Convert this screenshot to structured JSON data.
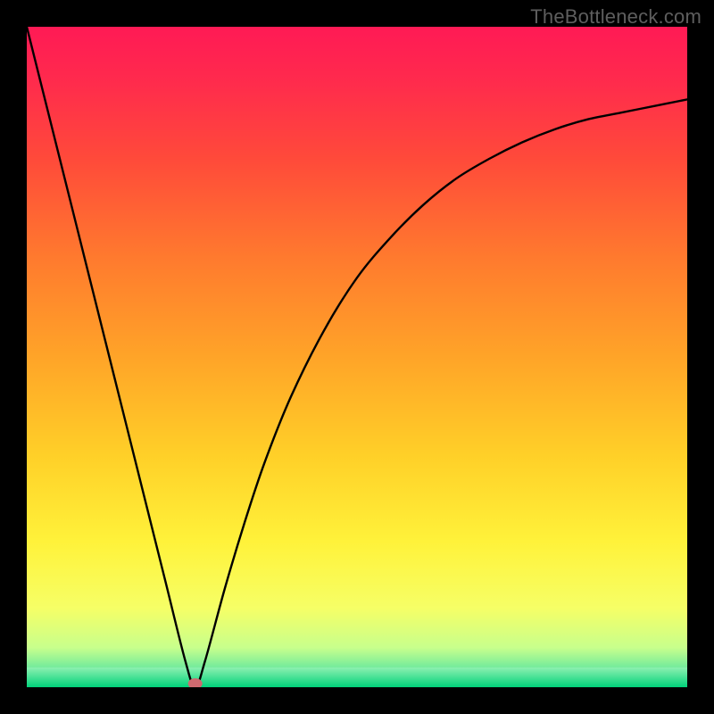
{
  "watermark": "TheBottleneck.com",
  "chart_data": {
    "type": "line",
    "title": "",
    "xlabel": "",
    "ylabel": "",
    "xlim": [
      0,
      100
    ],
    "ylim": [
      0,
      100
    ],
    "background_gradient": {
      "stops": [
        {
          "offset": 0.0,
          "color": "#ff1a55"
        },
        {
          "offset": 0.08,
          "color": "#ff2a4d"
        },
        {
          "offset": 0.2,
          "color": "#ff4a3a"
        },
        {
          "offset": 0.35,
          "color": "#ff7a2e"
        },
        {
          "offset": 0.5,
          "color": "#ffa428"
        },
        {
          "offset": 0.65,
          "color": "#ffd028"
        },
        {
          "offset": 0.78,
          "color": "#fff23a"
        },
        {
          "offset": 0.88,
          "color": "#f6ff66"
        },
        {
          "offset": 0.94,
          "color": "#c8ff8c"
        },
        {
          "offset": 0.975,
          "color": "#66e89e"
        },
        {
          "offset": 1.0,
          "color": "#00d27a"
        }
      ]
    },
    "series": [
      {
        "name": "bottleneck-curve",
        "x": [
          0,
          3,
          6,
          9,
          12,
          15,
          18,
          21,
          24,
          25.5,
          27,
          30,
          33,
          36,
          40,
          45,
          50,
          55,
          60,
          65,
          70,
          75,
          80,
          85,
          90,
          95,
          100
        ],
        "values": [
          100,
          88,
          76,
          64,
          52,
          40,
          28,
          16,
          4,
          0,
          4,
          15,
          25,
          34,
          44,
          54,
          62,
          68,
          73,
          77,
          80,
          82.5,
          84.5,
          86,
          87,
          88,
          89
        ]
      }
    ],
    "marker": {
      "name": "minimum-point",
      "x": 25.5,
      "y": 0,
      "color": "#cf6a70"
    },
    "baseline_band": {
      "y_from": 0,
      "y_to": 3,
      "color_top": "#8df0b0",
      "color_bottom": "#00d27a"
    }
  }
}
